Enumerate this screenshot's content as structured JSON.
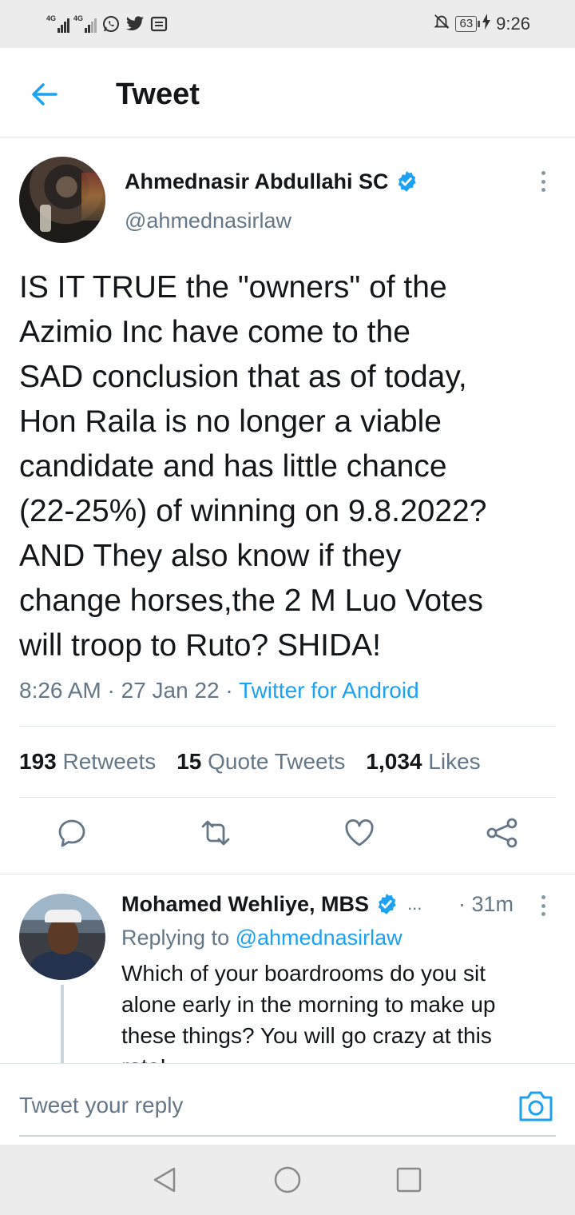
{
  "status_bar": {
    "signal_1": "4G",
    "signal_2": "4G",
    "battery": "63",
    "time": "9:26",
    "icons": [
      "whatsapp-icon",
      "twitter-icon",
      "news-icon",
      "mute-icon",
      "charging-icon"
    ]
  },
  "header": {
    "title": "Tweet",
    "back_icon": "arrow-left-icon"
  },
  "tweet": {
    "author_name": "Ahmednasir Abdullahi SC",
    "handle": "@ahmednasirlaw",
    "text": "IS IT TRUE the \"owners\" of the\nAzimio Inc have come to the\nSAD conclusion that as of today,\nHon Raila is no longer a viable\ncandidate and has little chance\n(22-25%) of winning on 9.8.2022?\nAND They also know if they\nchange horses,the 2 M Luo Votes\nwill troop to Ruto? SHIDA!",
    "time": "8:26 AM",
    "date": "27 Jan 22",
    "separator": "·",
    "source": "Twitter for Android",
    "stats": {
      "retweets_count": "193",
      "retweets_label": "Retweets",
      "quotes_count": "15",
      "quotes_label": "Quote Tweets",
      "likes_count": "1,034",
      "likes_label": "Likes"
    }
  },
  "reply": {
    "author_name": "Mohamed Wehliye, MBS",
    "ellipsis": "...",
    "time": "· 31m",
    "replying_prefix": "Replying to",
    "replying_handle": "@ahmednasirlaw",
    "text": "Which of your boardrooms do you sit alone early in the morning to make up these things? You will go crazy at this rate!"
  },
  "composer": {
    "placeholder": "Tweet your reply"
  },
  "colors": {
    "accent": "#1da1f2",
    "secondary_text": "#657786",
    "divider": "#e1e8ed"
  }
}
